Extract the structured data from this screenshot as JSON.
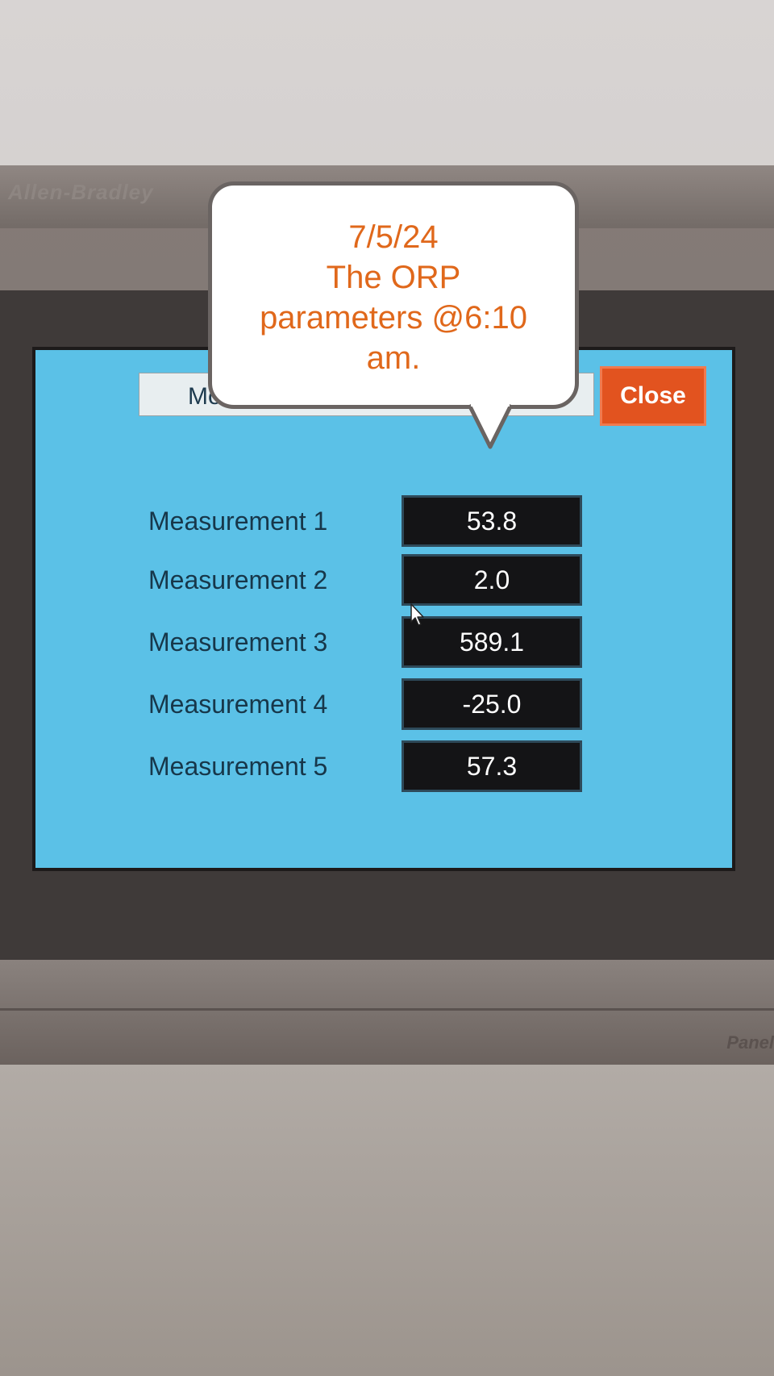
{
  "device": {
    "brand": "Allen-Bradley",
    "product": "Panel"
  },
  "screen": {
    "title_field": "Mo",
    "close_button": "Close",
    "measurements": [
      {
        "label": "Measurement 1",
        "value": "53.8"
      },
      {
        "label": "Measurement 2",
        "value": "2.0"
      },
      {
        "label": "Measurement 3",
        "value": "589.1"
      },
      {
        "label": "Measurement 4",
        "value": "-25.0"
      },
      {
        "label": "Measurement 5",
        "value": "57.3"
      }
    ]
  },
  "annotation": {
    "lines": [
      "7/5/24",
      "The ORP",
      "parameters @6:10",
      "am."
    ]
  },
  "colors": {
    "screen_background": "#5bc1e7",
    "close_button": "#e2531f",
    "annotation_text": "#e0681b",
    "value_field": "#141416"
  }
}
